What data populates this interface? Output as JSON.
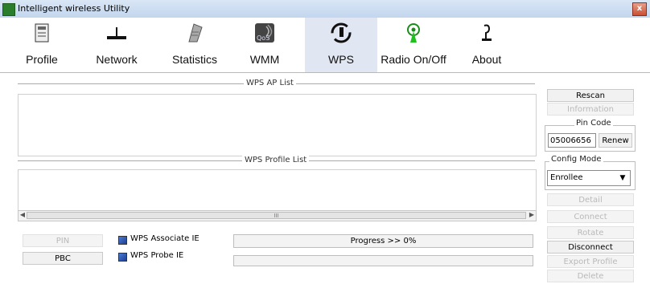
{
  "window": {
    "title": "Intelligent wireless Utility",
    "close_label": "x"
  },
  "toolbar": {
    "items": [
      {
        "label": "Profile",
        "icon": "profile-icon"
      },
      {
        "label": "Network",
        "icon": "router-icon"
      },
      {
        "label": "Statistics",
        "icon": "statistics-icon"
      },
      {
        "label": "WMM",
        "icon": "qos-icon",
        "badge": "QoS"
      },
      {
        "label": "WPS",
        "icon": "wps-icon",
        "active": true
      },
      {
        "label": "Radio On/Off",
        "icon": "radio-antenna-icon"
      },
      {
        "label": "About",
        "icon": "about-icon"
      }
    ]
  },
  "main": {
    "ap_list_title": "WPS AP List",
    "profile_list_title": "WPS Profile List",
    "scroll_grip": "III",
    "pin_button": "PIN",
    "pbc_button": "PBC",
    "associate_ie_label": "WPS Associate IE",
    "probe_ie_label": "WPS Probe IE",
    "progress_text": "Progress >> 0%"
  },
  "side": {
    "rescan": "Rescan",
    "information": "Information",
    "pin_code_label": "Pin Code",
    "pin_code_value": "05006656",
    "renew": "Renew",
    "config_mode_label": "Config Mode",
    "config_mode_value": "Enrollee",
    "detail": "Detail",
    "connect": "Connect",
    "rotate": "Rotate",
    "disconnect": "Disconnect",
    "export_profile": "Export Profile",
    "delete": "Delete"
  },
  "colors": {
    "accent_active_tab": "#e1e6f3",
    "checkbox": "#1e3f8f"
  }
}
